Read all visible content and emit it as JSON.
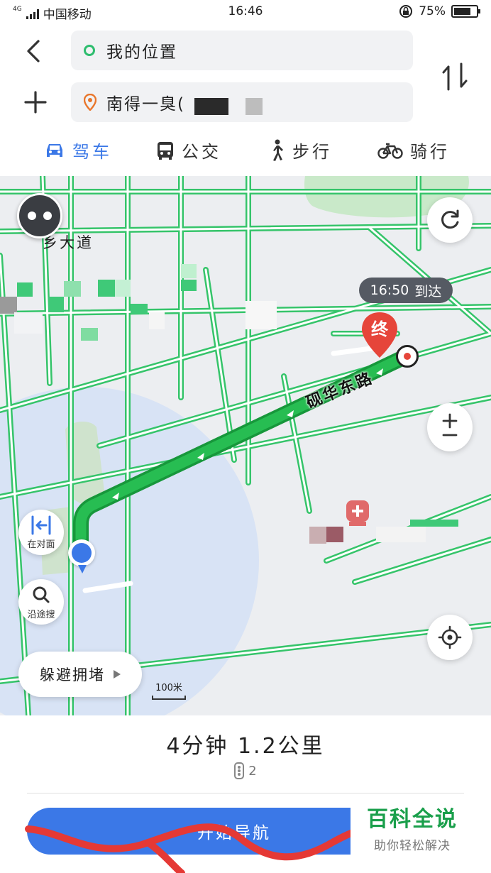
{
  "status_bar": {
    "network": "4G",
    "carrier": "中国移动",
    "time": "16:46",
    "battery_text": "75%",
    "battery_level": 0.75
  },
  "route": {
    "origin": "我的位置",
    "destination": "南得一臭("
  },
  "modes": [
    {
      "label": "驾车",
      "icon": "car-icon",
      "active": true
    },
    {
      "label": "公交",
      "icon": "bus-icon",
      "active": false
    },
    {
      "label": "步行",
      "icon": "walk-icon",
      "active": false
    },
    {
      "label": "骑行",
      "icon": "bike-icon",
      "active": false
    }
  ],
  "map": {
    "road_name": "砚华东路",
    "road_name_2": "乡大道",
    "eta_time": "16:50",
    "eta_text": "到达",
    "end_marker": "终",
    "scale": "100米",
    "route_color": "#22b24c",
    "road_color": "#37c86a",
    "side_buttons": {
      "opposite": "在对面",
      "search_along": "沿途搜"
    },
    "avoid_traffic": "躲避拥堵"
  },
  "summary": {
    "text": "4分钟  1.2公里",
    "traffic_lights": "2"
  },
  "start_button": "开始导航",
  "watermark": {
    "title": "百科全说",
    "subtitle": "助你轻松解决"
  },
  "colors": {
    "accent": "#3b78e7",
    "map_bg": "#eceef1"
  }
}
